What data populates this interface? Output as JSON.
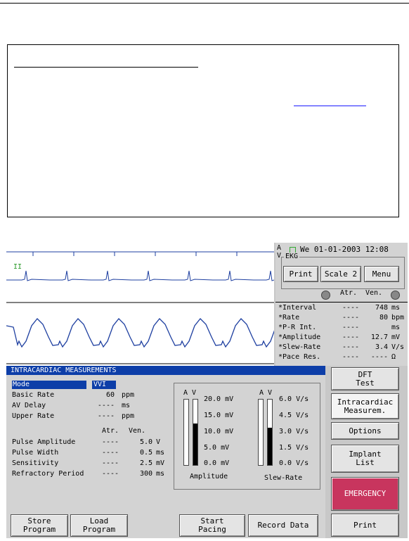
{
  "datetime": "We 01-01-2003 12:08",
  "av_label": "A\nV",
  "ekg_label": "EKG",
  "ekg_buttons": [
    "Print",
    "Scale 2",
    "Menu"
  ],
  "measurements": {
    "col_atr": "Atr.",
    "col_ven": "Ven.",
    "rows": [
      {
        "label": "*Interval",
        "atr": "----",
        "ven": "748",
        "unit": "ms"
      },
      {
        "label": "*Rate",
        "atr": "----",
        "ven": "80",
        "unit": "bpm"
      },
      {
        "label": "*P-R Int.",
        "atr": "----",
        "ven": "",
        "unit": "ms"
      },
      {
        "label": "*Amplitude",
        "atr": "----",
        "ven": "12.7",
        "unit": "mV"
      },
      {
        "label": "*Slew-Rate",
        "atr": "----",
        "ven": "3.4",
        "unit": "V/s"
      },
      {
        "label": "*Pace Res.",
        "atr": "----",
        "ven": "----",
        "unit": "Ω"
      }
    ]
  },
  "waveform_marker": "II",
  "panel": {
    "title": "INTRACARDIAC MEASUREMENTS",
    "params": [
      {
        "label": "Mode",
        "value": "VVI",
        "unit": ""
      },
      {
        "label": "Basic Rate",
        "value": "60",
        "unit": "ppm"
      },
      {
        "label": "AV Delay",
        "value": "----",
        "unit": "ms"
      },
      {
        "label": "Upper Rate",
        "value": "----",
        "unit": "ppm"
      }
    ],
    "col_atr": "Atr.",
    "col_ven": "Ven.",
    "pulse_rows": [
      {
        "label": "Pulse Amplitude",
        "atr": "----",
        "ven": "5.0",
        "unit": "V"
      },
      {
        "label": "Pulse Width",
        "atr": "----",
        "ven": "0.5",
        "unit": "ms"
      },
      {
        "label": "Sensitivity",
        "atr": "----",
        "ven": "2.5",
        "unit": "mV"
      },
      {
        "label": "Refractory Period",
        "atr": "----",
        "ven": "300",
        "unit": "ms"
      }
    ],
    "amp_gauge": {
      "head": "A V",
      "ticks": [
        "20.0  mV",
        "15.0  mV",
        "10.0  mV",
        "5.0  mV",
        "0.0  mV"
      ],
      "label": "Amplitude",
      "fill_fraction": 0.63
    },
    "slew_gauge": {
      "head": "A V",
      "ticks": [
        "6.0  V/s",
        "4.5  V/s",
        "3.0  V/s",
        "1.5  V/s",
        "0.0  V/s"
      ],
      "label": "Slew-Rate",
      "fill_fraction": 0.57
    }
  },
  "side_buttons": [
    "DFT\nTest",
    "Intracardiac\nMeasurem.",
    "Options",
    "Implant\nList",
    "EMERGENCY",
    "Print"
  ],
  "bottom_buttons": [
    "Store\nProgram",
    "Load\nProgram",
    "Start\nPacing",
    "Record Data"
  ]
}
